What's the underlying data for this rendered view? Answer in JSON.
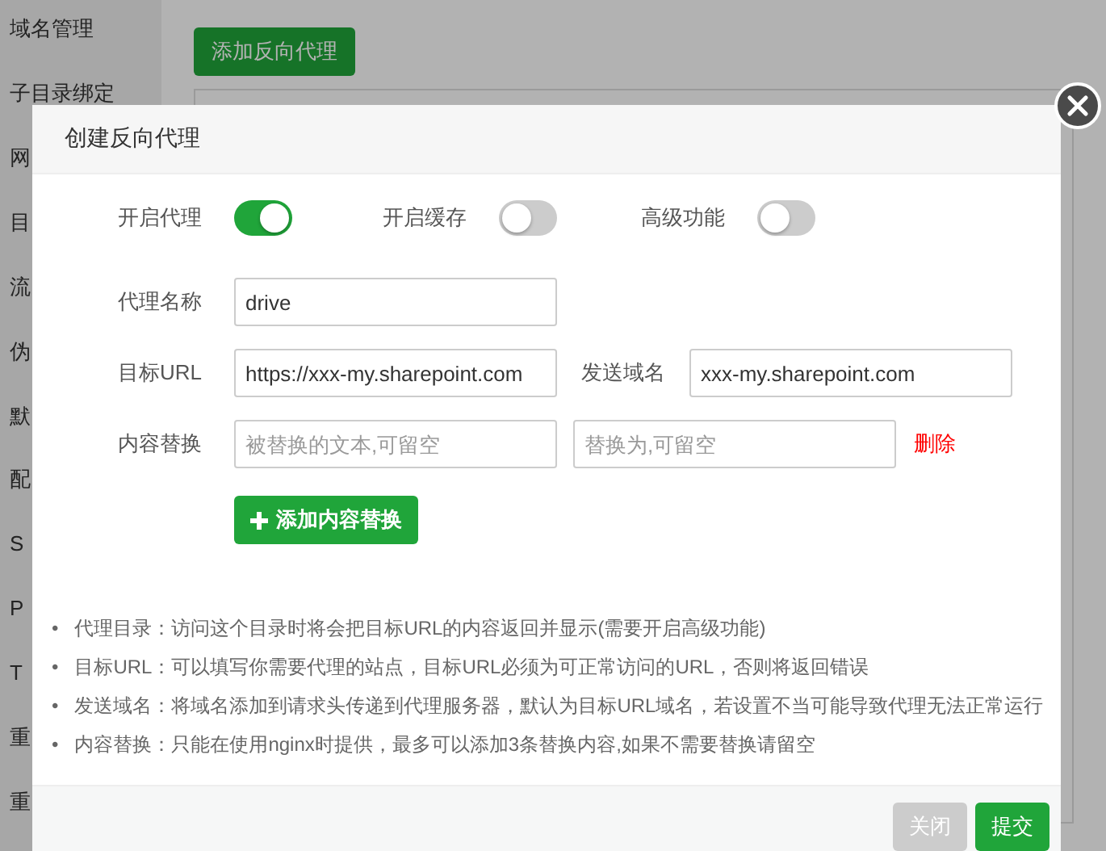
{
  "sidebar": {
    "items": [
      {
        "label": "域名管理"
      },
      {
        "label": "子目录绑定"
      },
      {
        "label": "网"
      },
      {
        "label": "目"
      },
      {
        "label": "流"
      },
      {
        "label": "伪"
      },
      {
        "label": "默"
      },
      {
        "label": "配"
      },
      {
        "label": "S"
      },
      {
        "label": "P"
      },
      {
        "label": "T"
      },
      {
        "label": "重"
      },
      {
        "label": "重"
      }
    ]
  },
  "add_proxy_button": "添加反向代理",
  "dialog": {
    "title": "创建反向代理",
    "toggles": [
      {
        "label": "开启代理",
        "on": true
      },
      {
        "label": "开启缓存",
        "on": false
      },
      {
        "label": "高级功能",
        "on": false
      }
    ],
    "name_field": {
      "label": "代理名称",
      "value": "drive"
    },
    "target_row": {
      "label": "目标URL",
      "value": "https://xxx-my.sharepoint.com",
      "send_label": "发送域名",
      "send_value": "xxx-my.sharepoint.com"
    },
    "replace_rows": [
      {
        "label": "内容替换",
        "find_placeholder": "被替换的文本,可留空",
        "replace_placeholder": "替换为,可留空",
        "delete": "删除"
      }
    ],
    "add_replace_button": "添加内容替换",
    "notes": [
      {
        "marker": "•",
        "text": "代理目录：访问这个目录时将会把目标URL的内容返回并显示(需要开启高级功能)"
      },
      {
        "marker": "•",
        "text": "目标URL：可以填写你需要代理的站点，目标URL必须为可正常访问的URL，否则将返回错误"
      },
      {
        "marker": "•",
        "text": "发送域名：将域名添加到请求头传递到代理服务器，默认为目标URL域名，若设置不当可能导致代理无法正常运行"
      },
      {
        "marker": "•",
        "text": "内容替换：只能在使用nginx时提供，最多可以添加3条替换内容,如果不需要替换请留空"
      }
    ],
    "buttons": [
      {
        "label": "关闭",
        "kind": "secondary"
      },
      {
        "label": "提交",
        "kind": "primary"
      }
    ]
  }
}
